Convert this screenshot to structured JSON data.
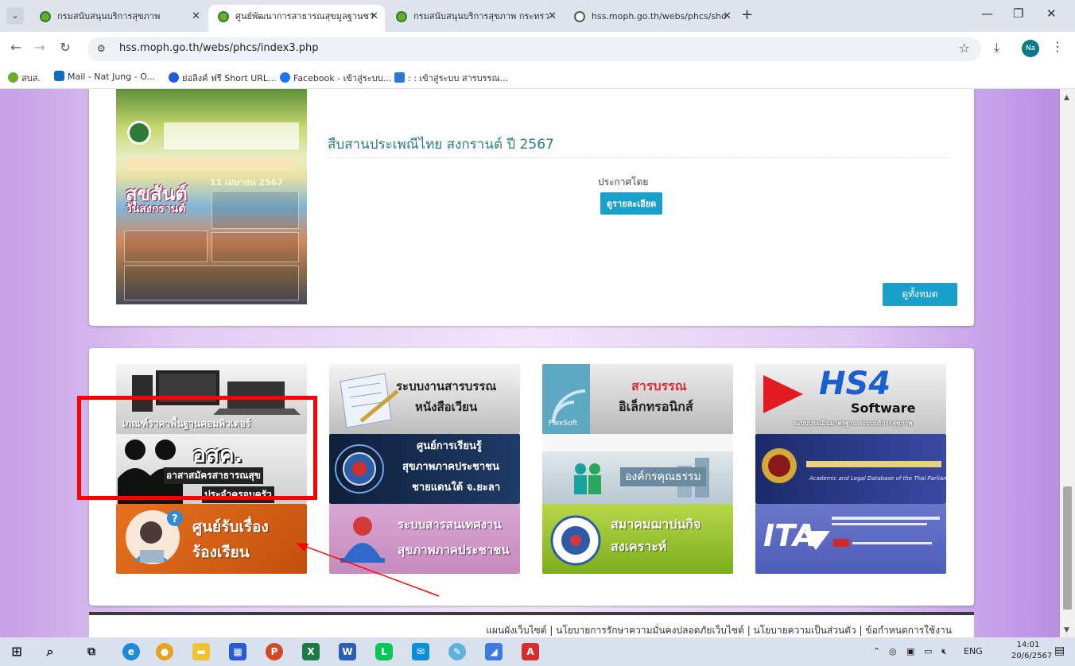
{
  "browser": {
    "tabs": [
      {
        "title": "กรมสนับสนุนบริการสุขภาพ",
        "active": false
      },
      {
        "title": "ศูนย์พัฒนาการสาธารณสุขมูลฐานชา",
        "active": true
      },
      {
        "title": "กรมสนับสนุนบริการสุขภาพ กระทรว",
        "active": false
      },
      {
        "title": "hss.moph.go.th/webs/phcs/sho",
        "active": false
      }
    ],
    "new_tab": "+",
    "url": "hss.moph.go.th/webs/phcs/index3.php",
    "profile_initials": "Na",
    "bookmarks": [
      "สบส.",
      "Mail - Nat Jung - O...",
      "ย่อลิงค์ ฟรี Short URL...",
      "Facebook - เข้าสู่ระบบ...",
      ": : เข้าสู่ระบบ สารบรรณ..."
    ]
  },
  "news": {
    "poster": {
      "headline_small": "สืบสานประเพณีไทย สงกรานต์ ปี ๒๕๖๗",
      "big_line1": "สุขสันต์",
      "big_line2": "วันสงกรานต์",
      "date": "11 เมษายน 2567"
    },
    "title": "สืบสานประเพณีไทย สงกรานต์ ปี 2567",
    "announced_by": "ประกาศโดย",
    "detail_button": "ดูรายละเอียด",
    "view_all_button": "ดูทั้งหมด"
  },
  "links": [
    {
      "id": "computer",
      "label": "เกณฑ์ราคาพื้นฐานคอมพิวเตอร์"
    },
    {
      "id": "saraban",
      "line1": "ระบบงานสารบรรณ",
      "line2": "หนังสือเวียน"
    },
    {
      "id": "esaraban",
      "line1": "สารบรรณ",
      "line2": "อิเล็กทรอนิกส์",
      "brand": "FlexSoft"
    },
    {
      "id": "hs4",
      "line1": "HS4",
      "line2": "Software",
      "line3": "ระบบประเมินมาตรฐาน ระบบบริการสุขภาพ"
    },
    {
      "id": "osk",
      "line1": "อสค.",
      "line2": "อาสาสมัครสาธารณสุข",
      "line3": "ประจำครอบครัว"
    },
    {
      "id": "learning",
      "line1": "ศูนย์การเรียนรู้",
      "line2": "สุขภาพภาคประชาชน",
      "line3": "ชายแดนใต้ จ.ยะลา"
    },
    {
      "id": "moral",
      "line1": "องค์กรคุณธรรม"
    },
    {
      "id": "legal",
      "line1": "Academic and Legal Database of the Thai Parliament"
    },
    {
      "id": "complaint",
      "line1": "ศูนย์รับเรื่อง",
      "line2": "ร้องเรียน"
    },
    {
      "id": "publicinfo",
      "line1": "ระบบสารสนเทศงาน",
      "line2": "สุขภาพภาคประชาชน"
    },
    {
      "id": "welfare",
      "line1": "สมาคมฌาปนกิจ",
      "line2": "สงเคราะห์"
    },
    {
      "id": "ita",
      "line1": "ITA"
    }
  ],
  "footer": {
    "links_text": "แผนผังเว็บไซต์ | นโยบายการรักษาความมั่นคงปลอดภัยเว็บไซต์ | นโยบายความเป็นส่วนตัว | ข้อกำหนดการใช้งาน"
  },
  "taskbar": {
    "lang": "ENG",
    "time": "14:01",
    "date": "20/6/2567"
  },
  "colors": {
    "accent_button": "#1aa1c9",
    "title_text": "#2d7d7d",
    "highlight": "#ff0000"
  }
}
